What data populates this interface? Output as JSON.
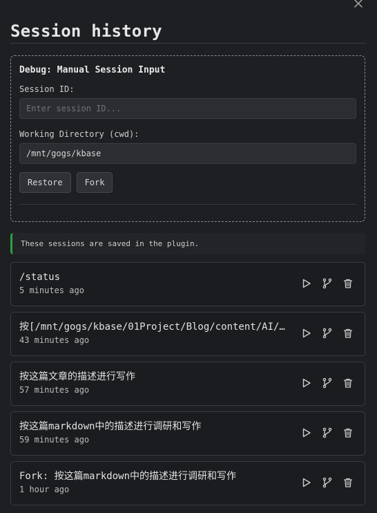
{
  "header": {
    "title": "Session history"
  },
  "debug": {
    "title": "Debug: Manual Session Input",
    "session_id_label": "Session ID:",
    "session_id_placeholder": "Enter session ID...",
    "session_id_value": "",
    "cwd_label": "Working Directory (cwd):",
    "cwd_value": "/mnt/gogs/kbase",
    "restore_label": "Restore",
    "fork_label": "Fork"
  },
  "notice": {
    "text": "These sessions are saved in the plugin."
  },
  "sessions": [
    {
      "title": "/status",
      "time": "5 minutes ago"
    },
    {
      "title": "按[/mnt/gogs/kbase/01Project/Blog/content/AI/…",
      "time": "43 minutes ago"
    },
    {
      "title": "按这篇文章的描述进行写作",
      "time": "57 minutes ago"
    },
    {
      "title": "按这篇markdown中的描述进行调研和写作",
      "time": "59 minutes ago"
    },
    {
      "title": "Fork: 按这篇markdown中的描述进行调研和写作",
      "time": "1 hour ago"
    }
  ],
  "icons": {
    "close": "close-icon",
    "play": "play-icon",
    "fork": "git-fork-icon",
    "delete": "trash-icon"
  },
  "colors": {
    "accent": "#2ea043",
    "background": "#1e1f22"
  }
}
